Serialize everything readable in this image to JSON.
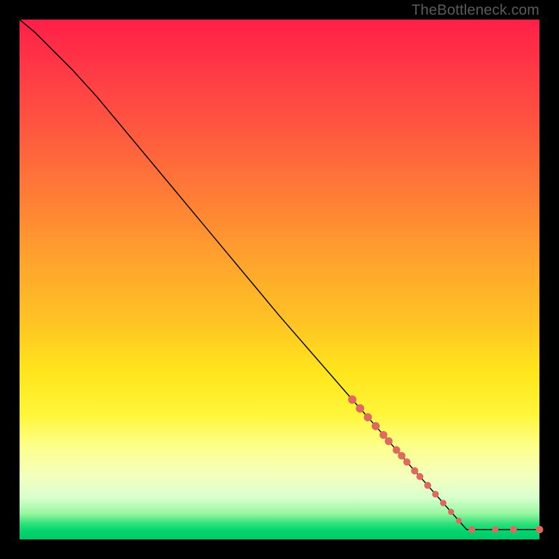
{
  "attribution": "TheBottleneck.com",
  "colors": {
    "marker": "#e0695f",
    "line": "#000000",
    "gradient_top": "#ff1f47",
    "gradient_bottom": "#00c968"
  },
  "chart_data": {
    "type": "line",
    "title": "",
    "xlabel": "",
    "ylabel": "",
    "xlim": [
      0,
      100
    ],
    "ylim": [
      0,
      100
    ],
    "x": [
      0,
      3,
      6,
      10,
      15,
      20,
      30,
      40,
      50,
      60,
      64,
      65.5,
      67,
      68.5,
      70,
      71,
      72.5,
      73.5,
      74.5,
      76,
      77,
      78.5,
      80,
      81.5,
      83,
      84.5,
      86,
      87,
      88.5,
      90,
      91.5,
      93,
      94,
      95,
      96.5,
      100
    ],
    "y": [
      100,
      97.5,
      94.5,
      90.5,
      85,
      79,
      67,
      55,
      43,
      31.5,
      26.9,
      25.2,
      23.5,
      21.8,
      20.1,
      18.9,
      17.2,
      16.1,
      14.9,
      13.2,
      12.1,
      10.4,
      8.7,
      7.0,
      5.3,
      3.6,
      1.9,
      1.9,
      1.9,
      1.9,
      1.9,
      1.9,
      1.9,
      1.9,
      1.9,
      1.9
    ],
    "series": [
      {
        "name": "curve",
        "x": [
          0,
          3,
          6,
          10,
          15,
          20,
          30,
          40,
          50,
          60,
          70,
          80,
          90,
          95,
          100
        ],
        "y": [
          100,
          97.5,
          94.5,
          90.5,
          85,
          79,
          67,
          55,
          43,
          31.5,
          20.1,
          8.7,
          1.9,
          1.9,
          1.9
        ]
      }
    ],
    "markers": [
      {
        "x": 64.0,
        "y": 26.9,
        "r": 6.0
      },
      {
        "x": 65.5,
        "y": 25.2,
        "r": 6.0
      },
      {
        "x": 67.0,
        "y": 23.5,
        "r": 5.8
      },
      {
        "x": 68.5,
        "y": 21.8,
        "r": 5.8
      },
      {
        "x": 70.0,
        "y": 20.1,
        "r": 5.6
      },
      {
        "x": 71.0,
        "y": 18.9,
        "r": 5.6
      },
      {
        "x": 72.5,
        "y": 17.2,
        "r": 5.4
      },
      {
        "x": 73.5,
        "y": 16.1,
        "r": 5.4
      },
      {
        "x": 74.5,
        "y": 14.9,
        "r": 5.2
      },
      {
        "x": 76.0,
        "y": 13.2,
        "r": 5.2
      },
      {
        "x": 77.0,
        "y": 12.1,
        "r": 5.0
      },
      {
        "x": 78.5,
        "y": 10.4,
        "r": 5.0
      },
      {
        "x": 80.0,
        "y": 8.7,
        "r": 4.8
      },
      {
        "x": 81.5,
        "y": 7.0,
        "r": 4.6
      },
      {
        "x": 83.0,
        "y": 5.3,
        "r": 4.4
      },
      {
        "x": 84.5,
        "y": 3.6,
        "r": 4.2
      },
      {
        "x": 87.0,
        "y": 1.9,
        "r": 4.8
      },
      {
        "x": 91.5,
        "y": 1.9,
        "r": 4.6
      },
      {
        "x": 95.0,
        "y": 1.9,
        "r": 5.0
      },
      {
        "x": 100.0,
        "y": 1.9,
        "r": 5.4
      }
    ]
  }
}
